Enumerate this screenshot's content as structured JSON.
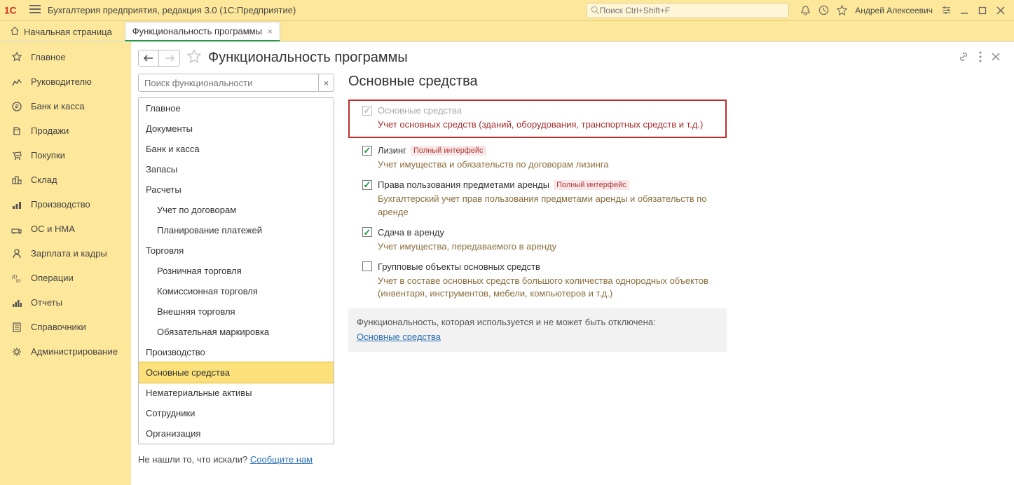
{
  "titlebar": {
    "app_title": "Бухгалтерия предприятия, редакция 3.0  (1С:Предприятие)",
    "search_placeholder": "Поиск Ctrl+Shift+F",
    "user": "Андрей Алексеевич"
  },
  "tabs": {
    "home": "Начальная страница",
    "active": "Функциональность программы"
  },
  "sidebar": {
    "items": [
      "Главное",
      "Руководителю",
      "Банк и касса",
      "Продажи",
      "Покупки",
      "Склад",
      "Производство",
      "ОС и НМА",
      "Зарплата и кадры",
      "Операции",
      "Отчеты",
      "Справочники",
      "Администрирование"
    ]
  },
  "content": {
    "title": "Функциональность программы",
    "search_placeholder": "Поиск функциональности",
    "tree": [
      {
        "label": "Главное"
      },
      {
        "label": "Документы"
      },
      {
        "label": "Банк и касса"
      },
      {
        "label": "Запасы"
      },
      {
        "label": "Расчеты"
      },
      {
        "label": "Учет по договорам",
        "sub": true
      },
      {
        "label": "Планирование платежей",
        "sub": true
      },
      {
        "label": "Торговля"
      },
      {
        "label": "Розничная торговля",
        "sub": true
      },
      {
        "label": "Комиссионная торговля",
        "sub": true
      },
      {
        "label": "Внешняя торговля",
        "sub": true
      },
      {
        "label": "Обязательная маркировка",
        "sub": true
      },
      {
        "label": "Производство"
      },
      {
        "label": "Основные средства",
        "active": true
      },
      {
        "label": "Нематериальные активы"
      },
      {
        "label": "Сотрудники"
      },
      {
        "label": "Организация"
      }
    ],
    "footer_text": "Не нашли то, что искали? ",
    "footer_link": "Сообщите нам"
  },
  "section": {
    "title": "Основные средства",
    "options": [
      {
        "label": "Основные средства",
        "checked": true,
        "disabled": true,
        "boxed": true,
        "desc": "Учет основных средств (зданий, оборудования, транспортных средств и т.д.)"
      },
      {
        "label": "Лизинг",
        "checked": true,
        "badge": "Полный интерфейс",
        "desc": "Учет имущества и обязательств  по договорам лизинга"
      },
      {
        "label": "Права пользования предметами аренды",
        "checked": true,
        "badge": "Полный интерфейс",
        "desc": "Бухгалтерский учет прав пользования предметами аренды и обязательств по аренде"
      },
      {
        "label": "Сдача в аренду",
        "checked": true,
        "desc": "Учет имущества, передаваемого в аренду"
      },
      {
        "label": "Групповые объекты основных средств",
        "checked": false,
        "desc": "Учет в составе основных средств большого количества однородных объектов (инвентаря, инструментов, мебели, компьютеров и т.д.)"
      }
    ],
    "locked_text": "Функциональность, которая используется и не может быть отключена:",
    "locked_link": "Основные средства"
  }
}
